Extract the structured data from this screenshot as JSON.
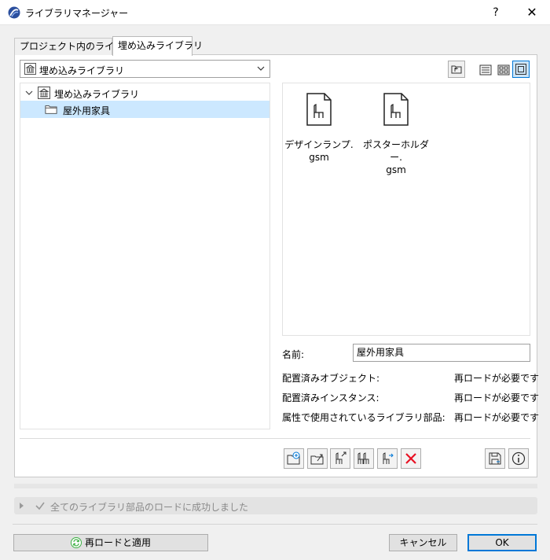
{
  "window": {
    "title": "ライブラリマネージャー",
    "help_label": "?",
    "close_label": "✕"
  },
  "tabs": [
    {
      "label": "プロジェクト内のライブラリ",
      "active": false
    },
    {
      "label": "埋め込みライブラリ",
      "active": true
    }
  ],
  "library_select": {
    "value": "埋め込みライブラリ",
    "icon": "library-icon"
  },
  "view_buttons": [
    "parent-folder-icon",
    "list-view-icon",
    "grid-view-icon",
    "preview-view-icon"
  ],
  "view_selected": "preview-view-icon",
  "tree": {
    "root": {
      "label": "埋め込みライブラリ",
      "icon": "library-icon",
      "expanded": true
    },
    "children": [
      {
        "label": "屋外用家具",
        "icon": "folder-icon",
        "selected": true
      }
    ]
  },
  "objects": [
    {
      "name_line1": "デザインランプ.",
      "name_line2": "gsm",
      "icon": "gsm-chair-file-icon"
    },
    {
      "name_line1": "ポスターホルダー.",
      "name_line2": "gsm",
      "icon": "gsm-chair-file-icon"
    }
  ],
  "info": {
    "name_label": "名前:",
    "name_value": "屋外用家具",
    "rows": [
      {
        "label": "配置済みオブジェクト:",
        "value": "再ロードが必要です"
      },
      {
        "label": "配置済みインスタンス:",
        "value": "再ロードが必要です"
      },
      {
        "label": "属性で使用されているライブラリ部品:",
        "value": "再ロードが必要です"
      }
    ]
  },
  "action_buttons": [
    "add-library-icon",
    "import-folder-icon",
    "export-object-icon",
    "duplicate-objects-icon",
    "move-object-icon",
    "delete-icon",
    "save-icon",
    "info-icon"
  ],
  "status": {
    "message": "全てのライブラリ部品のロードに成功しました"
  },
  "footer": {
    "reload_label": "再ロードと適用",
    "cancel_label": "キャンセル",
    "ok_label": "OK"
  },
  "colors": {
    "accent": "#0078d7",
    "selection": "#cce8ff",
    "delete_red": "#e81123",
    "reload_green": "#3cb043"
  }
}
